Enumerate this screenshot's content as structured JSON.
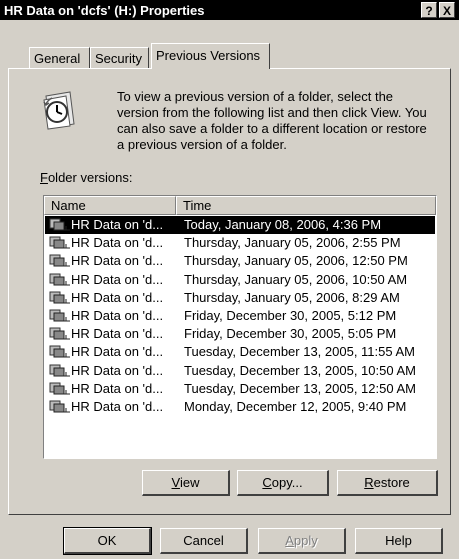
{
  "window": {
    "title": "HR Data on 'dcfs' (H:) Properties",
    "help_btn": "?",
    "close_btn": "X"
  },
  "tabs": [
    {
      "label": "General",
      "active": false
    },
    {
      "label": "Security",
      "active": false
    },
    {
      "label": "Previous Versions",
      "active": true
    }
  ],
  "info": {
    "text": "To view a previous version of a folder, select the version from the following list and then click View. You can also save a folder to a different location or restore a previous version of a folder.",
    "icon": "clock-history-icon"
  },
  "folder_versions": {
    "label_first": "F",
    "label_rest": "older versions:",
    "columns": {
      "name": "Name",
      "time": "Time"
    },
    "rows": [
      {
        "name": "HR Data on 'd...",
        "time": "Today, January 08, 2006, 4:36 PM",
        "selected": true
      },
      {
        "name": "HR Data on 'd...",
        "time": "Thursday, January 05, 2006, 2:55 PM"
      },
      {
        "name": "HR Data on 'd...",
        "time": "Thursday, January 05, 2006, 12:50 PM"
      },
      {
        "name": "HR Data on 'd...",
        "time": "Thursday, January 05, 2006, 10:50 AM"
      },
      {
        "name": "HR Data on 'd...",
        "time": "Thursday, January 05, 2006, 8:29 AM"
      },
      {
        "name": "HR Data on 'd...",
        "time": "Friday, December 30, 2005, 5:12 PM"
      },
      {
        "name": "HR Data on 'd...",
        "time": "Friday, December 30, 2005, 5:05 PM"
      },
      {
        "name": "HR Data on 'd...",
        "time": "Tuesday, December 13, 2005, 11:55 AM"
      },
      {
        "name": "HR Data on 'd...",
        "time": "Tuesday, December 13, 2005, 10:50 AM"
      },
      {
        "name": "HR Data on 'd...",
        "time": "Tuesday, December 13, 2005, 12:50 AM"
      },
      {
        "name": "HR Data on 'd...",
        "time": "Monday, December 12, 2005, 9:40 PM"
      }
    ]
  },
  "actions": {
    "view_u": "V",
    "view_rest": "iew",
    "copy_u": "C",
    "copy_rest": "opy...",
    "restore_u": "R",
    "restore_rest": "estore"
  },
  "footer": {
    "ok": "OK",
    "cancel": "Cancel",
    "apply_u": "A",
    "apply_rest": "pply",
    "help": "Help"
  }
}
